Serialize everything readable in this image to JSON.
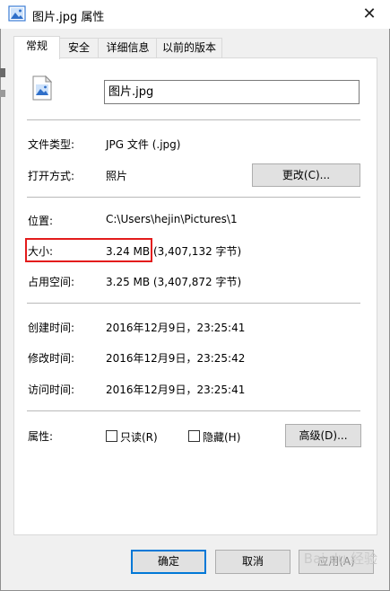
{
  "window": {
    "title": "图片.jpg 属性",
    "title_icon": "image-file-icon",
    "close_glyph": "✕"
  },
  "tabs": [
    {
      "label": "常规",
      "active": true
    },
    {
      "label": "安全",
      "active": false
    },
    {
      "label": "详细信息",
      "active": false
    },
    {
      "label": "以前的版本",
      "active": false
    }
  ],
  "general": {
    "file_name": "图片.jpg",
    "file_type_label": "文件类型:",
    "file_type_value": "JPG 文件 (.jpg)",
    "opens_with_label": "打开方式:",
    "opens_with_value": "照片",
    "change_button": "更改(C)...",
    "location_label": "位置:",
    "location_value": "C:\\Users\\hejin\\Pictures\\1",
    "size_label": "大小:",
    "size_value": "3.24 MB",
    "size_bytes": "(3,407,132 字节)",
    "size_on_disk_label": "占用空间:",
    "size_on_disk_value": "3.25 MB (3,407,872 字节)",
    "created_label": "创建时间:",
    "created_value": "2016年12月9日，23:25:41",
    "modified_label": "修改时间:",
    "modified_value": "2016年12月9日，23:25:42",
    "accessed_label": "访问时间:",
    "accessed_value": "2016年12月9日，23:25:41",
    "attributes_label": "属性:",
    "readonly_label": "只读(R)",
    "readonly_checked": false,
    "hidden_label": "隐藏(H)",
    "hidden_checked": false,
    "advanced_button": "高级(D)..."
  },
  "footer": {
    "ok_button": "确定",
    "cancel_button": "取消",
    "apply_button": "应用(A)"
  },
  "watermark": "Bai du 经验",
  "colors": {
    "highlight_box": "#e31c1c",
    "default_button_border": "#0078d7"
  }
}
